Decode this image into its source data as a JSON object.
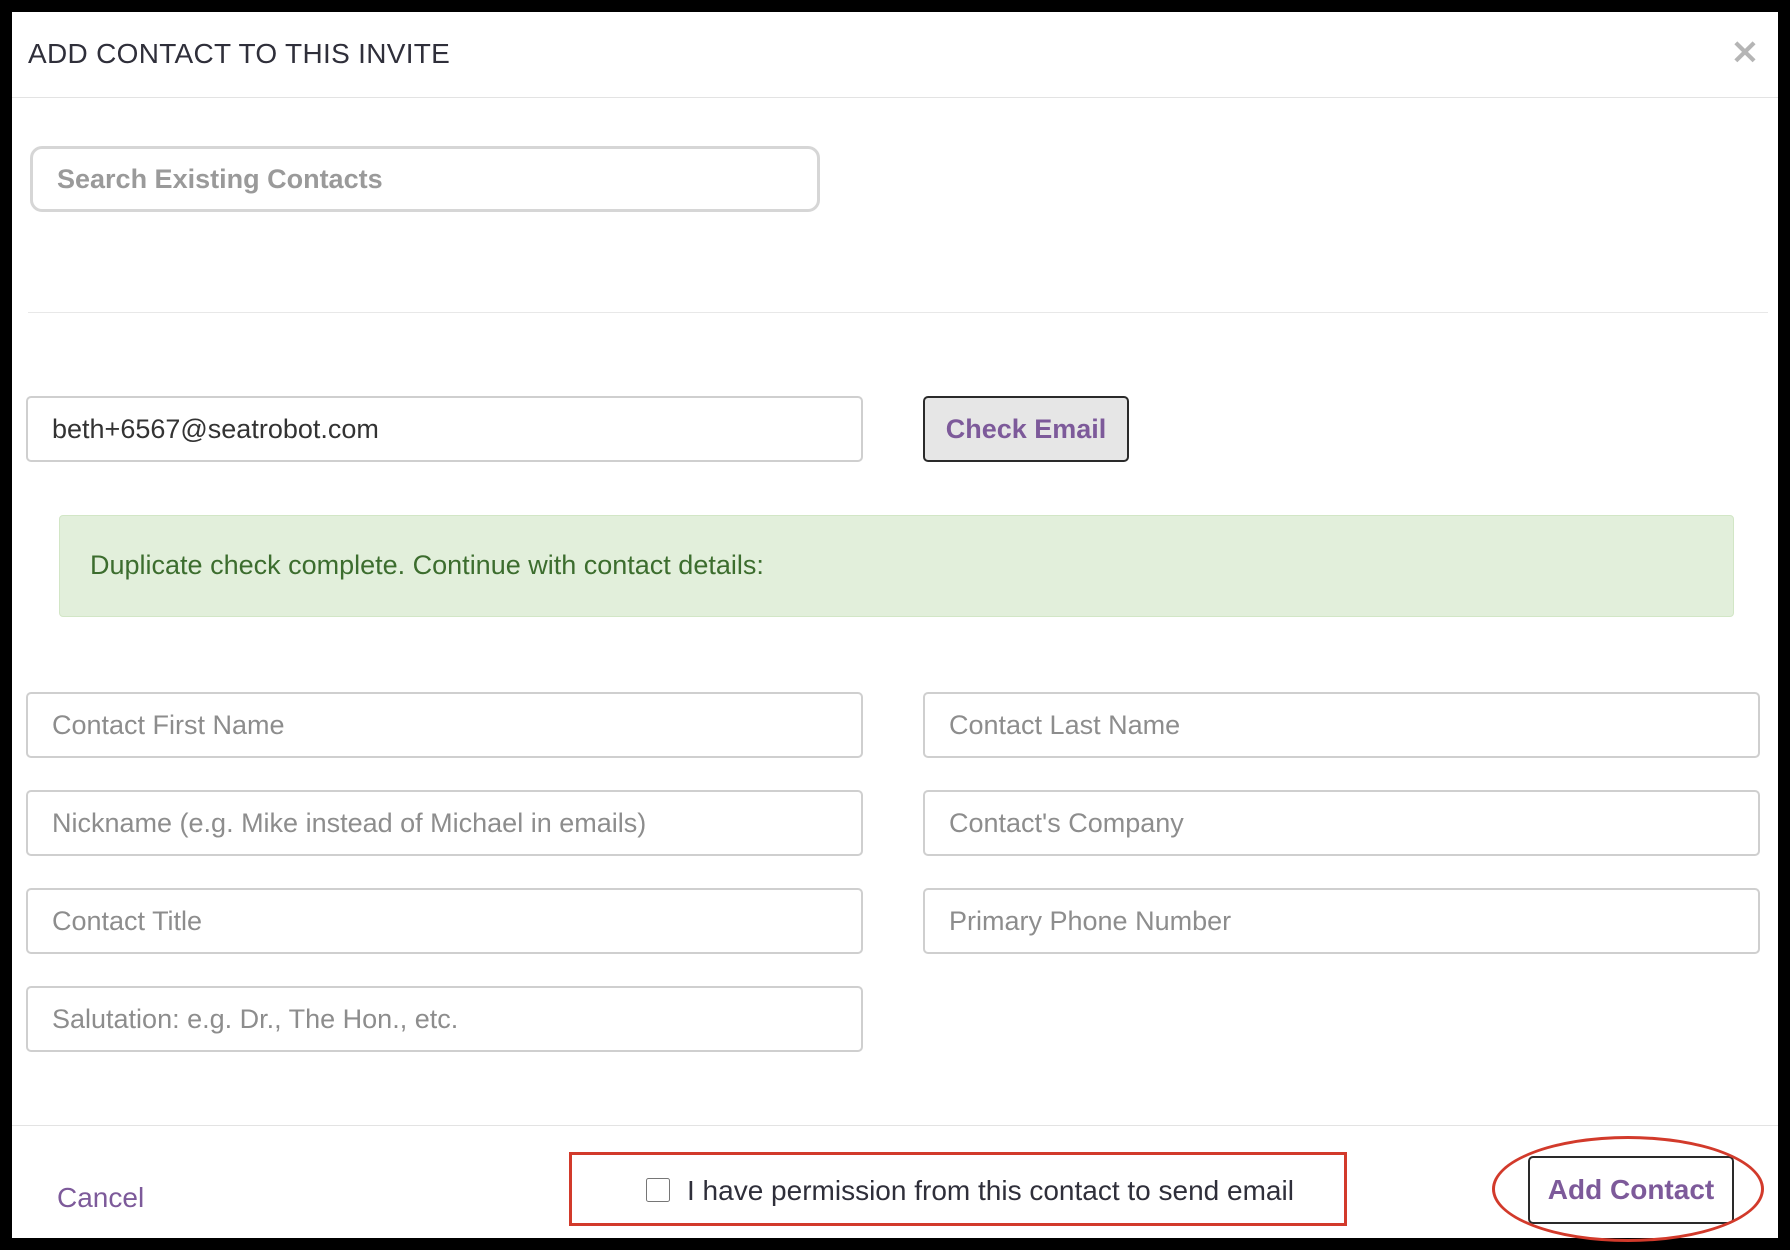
{
  "dialog": {
    "title": "ADD CONTACT TO THIS INVITE",
    "close_glyph": "×"
  },
  "search": {
    "placeholder": "Search Existing Contacts"
  },
  "email": {
    "value": "beth+6567@seatrobot.com",
    "check_button_label": "Check Email"
  },
  "alert": {
    "message": "Duplicate check complete. Continue with contact details:",
    "background_color": "#e2efdb",
    "text_color": "#3c6d2e"
  },
  "fields": {
    "first_name": {
      "placeholder": "Contact First Name"
    },
    "last_name": {
      "placeholder": "Contact Last Name"
    },
    "nickname": {
      "placeholder": "Nickname (e.g. Mike instead of Michael in emails)"
    },
    "company": {
      "placeholder": "Contact's Company"
    },
    "title": {
      "placeholder": "Contact Title"
    },
    "phone": {
      "placeholder": "Primary Phone Number"
    },
    "salutation": {
      "placeholder": "Salutation: e.g. Dr., The Hon., etc."
    }
  },
  "footer": {
    "cancel_label": "Cancel",
    "permission_label": "I have permission from this contact to send email",
    "permission_checked": false,
    "add_button_label": "Add Contact"
  },
  "colors": {
    "accent": "#7d5a9a",
    "annotation_red": "#d23a2b"
  }
}
